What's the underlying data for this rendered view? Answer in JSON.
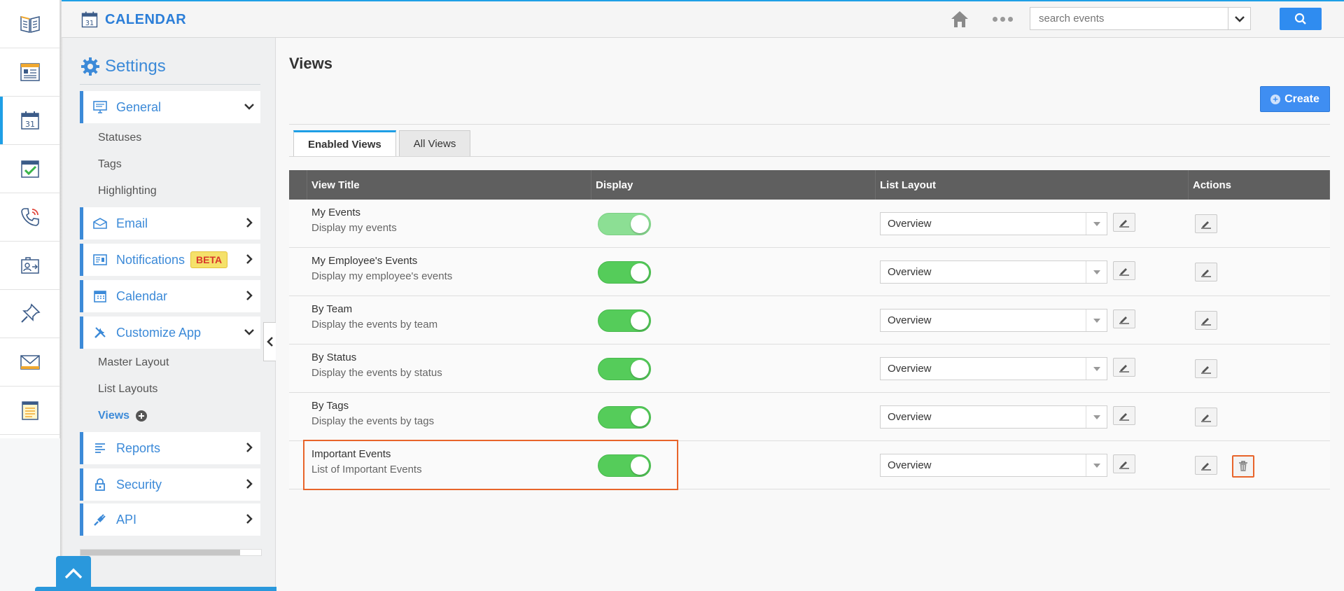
{
  "app": {
    "title": "CALENDAR",
    "calendar_icon_day": "31"
  },
  "search": {
    "placeholder": "search events"
  },
  "rail": {
    "items": [
      "book-icon",
      "news-icon",
      "calendar-icon",
      "checklist-icon",
      "phone-icon",
      "contact-transfer-icon",
      "pin-icon",
      "mail-icon",
      "notes-icon"
    ],
    "active_index": 2
  },
  "settings": {
    "title": "Settings",
    "menu": {
      "general": "General",
      "email": "Email",
      "notifications": "Notifications",
      "beta": "BETA",
      "calendar": "Calendar",
      "customize": "Customize App",
      "reports": "Reports",
      "security": "Security",
      "api": "API"
    },
    "general_sub": [
      "Statuses",
      "Tags",
      "Highlighting"
    ],
    "customize_sub": [
      "Master Layout",
      "List Layouts",
      "Views"
    ]
  },
  "main": {
    "title": "Views",
    "create_label": "Create",
    "tabs": [
      "Enabled Views",
      "All Views"
    ],
    "columns": [
      "View Title",
      "Display",
      "List Layout",
      "Actions"
    ],
    "rows": [
      {
        "title": "My Events",
        "desc": "Display my events",
        "layout": "Overview",
        "enabled": true
      },
      {
        "title": "My Employee's Events",
        "desc": "Display my employee's events",
        "layout": "Overview",
        "enabled": true
      },
      {
        "title": "By Team",
        "desc": "Display the events by team",
        "layout": "Overview",
        "enabled": true
      },
      {
        "title": "By Status",
        "desc": "Display the events by status",
        "layout": "Overview",
        "enabled": true
      },
      {
        "title": "By Tags",
        "desc": "Display the events by tags",
        "layout": "Overview",
        "enabled": true
      },
      {
        "title": "Important Events",
        "desc": "List of Important Events",
        "layout": "Overview",
        "enabled": true
      }
    ]
  },
  "colors": {
    "accent": "#3c8ad8",
    "toggle_on": "#55cc5a",
    "highlight": "#e8642a"
  }
}
